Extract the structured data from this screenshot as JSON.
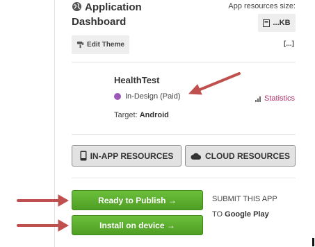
{
  "header": {
    "title": "Application Dashboard",
    "resources_size_label": "App resources size:",
    "resources_size_value": "...KB",
    "edit_theme_label": "Edit Theme",
    "more_label": "[...]"
  },
  "app": {
    "name": "HealthTest",
    "status": "In-Design (Paid)",
    "status_color": "#9b59b6",
    "target_label": "Target:",
    "target_value": "Android",
    "statistics_label": "Statistics"
  },
  "resources": {
    "in_app_label": "IN-APP RESOURCES",
    "cloud_label": "CLOUD RESOURCES"
  },
  "publish": {
    "ready_label": "Ready to Publish →",
    "install_label": "Install on device →",
    "submit_label": "SUBMIT THIS APP",
    "to_label": "TO",
    "store_label": "Google Play"
  },
  "colors": {
    "accent_green": "#5aad2e",
    "annotation_arrow": "#c0504d",
    "statistics_link": "#b0306a"
  },
  "icons": [
    "globe-icon",
    "file-icon",
    "paint-icon",
    "bar-chart-icon",
    "phone-icon",
    "cloud-icon",
    "annotation-arrow"
  ]
}
